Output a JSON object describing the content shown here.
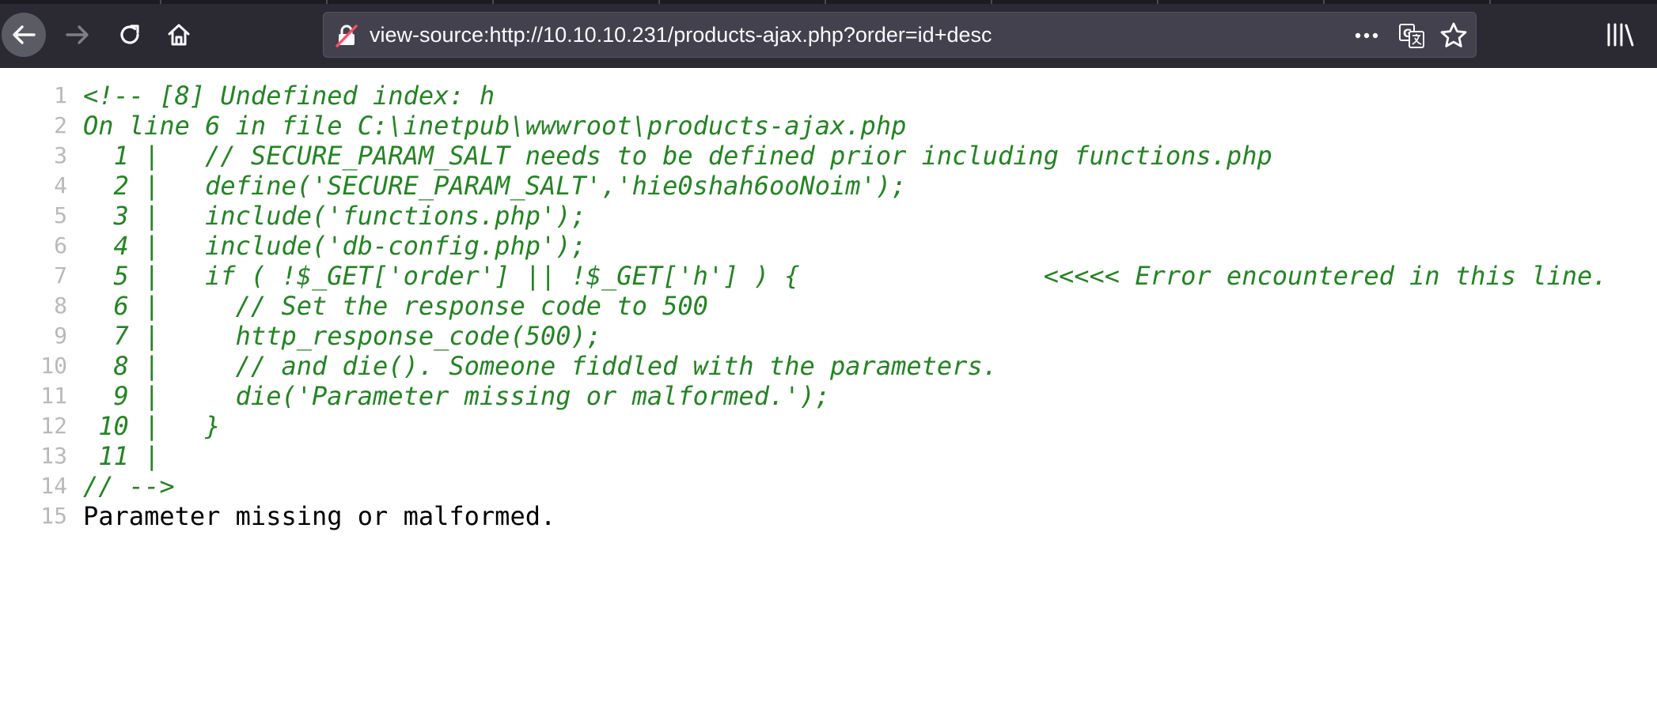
{
  "browser": {
    "address": "view-source:http://10.10.10.231/products-ajax.php?order=id+desc",
    "icons": {
      "back": "back-arrow-icon",
      "forward": "forward-arrow-icon",
      "reload": "reload-icon",
      "home": "home-icon",
      "insecure": "insecure-lock-icon",
      "page_actions": "more-horizontal-icon",
      "translate": "translate-icon",
      "bookmark": "star-icon",
      "library": "library-icon"
    },
    "colors": {
      "toolbar": "#2b2a33",
      "urlbar": "#42414d",
      "comment_green": "#238423",
      "line_number_gray": "#b9b9b9"
    }
  },
  "source": {
    "lines": [
      {
        "n": "1",
        "text": "<!-- [8] Undefined index: h",
        "style": "comment"
      },
      {
        "n": "2",
        "text": "On line 6 in file C:\\inetpub\\wwwroot\\products-ajax.php",
        "style": "comment"
      },
      {
        "n": "3",
        "text": "  1 |   // SECURE_PARAM_SALT needs to be defined prior including functions.php",
        "style": "comment"
      },
      {
        "n": "4",
        "text": "  2 |   define('SECURE_PARAM_SALT','hie0shah6ooNoim');",
        "style": "comment"
      },
      {
        "n": "5",
        "text": "  3 |   include('functions.php');",
        "style": "comment"
      },
      {
        "n": "6",
        "text": "  4 |   include('db-config.php');",
        "style": "comment"
      },
      {
        "n": "7",
        "text": "  5 |   if ( !$_GET['order'] || !$_GET['h'] ) {                <<<<< Error encountered in this line.",
        "style": "comment"
      },
      {
        "n": "8",
        "text": "  6 |     // Set the response code to 500",
        "style": "comment"
      },
      {
        "n": "9",
        "text": "  7 |     http_response_code(500);",
        "style": "comment"
      },
      {
        "n": "10",
        "text": "  8 |     // and die(). Someone fiddled with the parameters.",
        "style": "comment"
      },
      {
        "n": "11",
        "text": "  9 |     die('Parameter missing or malformed.');",
        "style": "comment"
      },
      {
        "n": "12",
        "text": " 10 |   }",
        "style": "comment"
      },
      {
        "n": "13",
        "text": " 11 |",
        "style": "comment"
      },
      {
        "n": "14",
        "text": "// -->",
        "style": "comment"
      },
      {
        "n": "15",
        "text": "Parameter missing or malformed.",
        "style": "text"
      }
    ]
  }
}
